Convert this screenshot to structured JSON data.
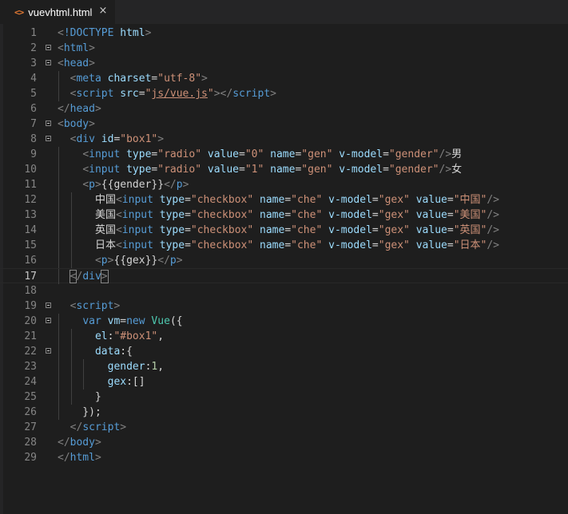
{
  "tab": {
    "icon": "html-file-icon",
    "title": "vuevhtml.html",
    "close": "×"
  },
  "colors": {
    "tag": "#569cd6",
    "bracket": "#808080",
    "attribute": "#9cdcfe",
    "string": "#ce9178",
    "text": "#d4d4d4",
    "keyword": "#569cd6",
    "class": "#4ec9b0",
    "number": "#b5cea8",
    "line_number": "#858585"
  },
  "lines": [
    {
      "n": "1",
      "tokens": [
        [
          "brk",
          "<"
        ],
        [
          "tag",
          "!DOCTYPE"
        ],
        [
          "txt",
          " "
        ],
        [
          "attr",
          "html"
        ],
        [
          "brk",
          ">"
        ]
      ]
    },
    {
      "n": "2",
      "tokens": [
        [
          "brk",
          "<"
        ],
        [
          "tag",
          "html"
        ],
        [
          "brk",
          ">"
        ]
      ]
    },
    {
      "n": "3",
      "tokens": [
        [
          "brk",
          "<"
        ],
        [
          "tag",
          "head"
        ],
        [
          "brk",
          ">"
        ]
      ]
    },
    {
      "n": "4",
      "tokens": [
        [
          "txt",
          "  "
        ],
        [
          "brk",
          "<"
        ],
        [
          "tag",
          "meta"
        ],
        [
          "txt",
          " "
        ],
        [
          "attr",
          "charset"
        ],
        [
          "txt",
          "="
        ],
        [
          "str",
          "\"utf-8\""
        ],
        [
          "brk",
          ">"
        ]
      ]
    },
    {
      "n": "5",
      "tokens": [
        [
          "txt",
          "  "
        ],
        [
          "brk",
          "<"
        ],
        [
          "tag",
          "script"
        ],
        [
          "txt",
          " "
        ],
        [
          "attr",
          "src"
        ],
        [
          "txt",
          "="
        ],
        [
          "str",
          "\""
        ],
        [
          "strlink",
          "js/vue.js"
        ],
        [
          "str",
          "\""
        ],
        [
          "brk",
          "></"
        ],
        [
          "tag",
          "script"
        ],
        [
          "brk",
          ">"
        ]
      ]
    },
    {
      "n": "6",
      "tokens": [
        [
          "brk",
          "</"
        ],
        [
          "tag",
          "head"
        ],
        [
          "brk",
          ">"
        ]
      ]
    },
    {
      "n": "7",
      "tokens": [
        [
          "brk",
          "<"
        ],
        [
          "tag",
          "body"
        ],
        [
          "brk",
          ">"
        ]
      ]
    },
    {
      "n": "8",
      "tokens": [
        [
          "txt",
          "  "
        ],
        [
          "brk",
          "<"
        ],
        [
          "tag",
          "div"
        ],
        [
          "txt",
          " "
        ],
        [
          "attr",
          "id"
        ],
        [
          "txt",
          "="
        ],
        [
          "str",
          "\"box1\""
        ],
        [
          "brk",
          ">"
        ]
      ]
    },
    {
      "n": "9",
      "tokens": [
        [
          "txt",
          "    "
        ],
        [
          "brk",
          "<"
        ],
        [
          "tag",
          "input"
        ],
        [
          "txt",
          " "
        ],
        [
          "attr",
          "type"
        ],
        [
          "txt",
          "="
        ],
        [
          "str",
          "\"radio\""
        ],
        [
          "txt",
          " "
        ],
        [
          "attr",
          "value"
        ],
        [
          "txt",
          "="
        ],
        [
          "str",
          "\"0\""
        ],
        [
          "txt",
          " "
        ],
        [
          "attr",
          "name"
        ],
        [
          "txt",
          "="
        ],
        [
          "str",
          "\"gen\""
        ],
        [
          "txt",
          " "
        ],
        [
          "attr",
          "v-model"
        ],
        [
          "txt",
          "="
        ],
        [
          "str",
          "\"gender\""
        ],
        [
          "brk",
          "/>"
        ],
        [
          "txt",
          "男"
        ]
      ]
    },
    {
      "n": "10",
      "tokens": [
        [
          "txt",
          "    "
        ],
        [
          "brk",
          "<"
        ],
        [
          "tag",
          "input"
        ],
        [
          "txt",
          " "
        ],
        [
          "attr",
          "type"
        ],
        [
          "txt",
          "="
        ],
        [
          "str",
          "\"radio\""
        ],
        [
          "txt",
          " "
        ],
        [
          "attr",
          "value"
        ],
        [
          "txt",
          "="
        ],
        [
          "str",
          "\"1\""
        ],
        [
          "txt",
          " "
        ],
        [
          "attr",
          "name"
        ],
        [
          "txt",
          "="
        ],
        [
          "str",
          "\"gen\""
        ],
        [
          "txt",
          " "
        ],
        [
          "attr",
          "v-model"
        ],
        [
          "txt",
          "="
        ],
        [
          "str",
          "\"gender\""
        ],
        [
          "brk",
          "/>"
        ],
        [
          "txt",
          "女"
        ]
      ]
    },
    {
      "n": "11",
      "tokens": [
        [
          "txt",
          "    "
        ],
        [
          "brk",
          "<"
        ],
        [
          "tag",
          "p"
        ],
        [
          "brk",
          ">"
        ],
        [
          "txt",
          "{{gender}}"
        ],
        [
          "brk",
          "</"
        ],
        [
          "tag",
          "p"
        ],
        [
          "brk",
          ">"
        ]
      ]
    },
    {
      "n": "12",
      "tokens": [
        [
          "txt",
          "      中国"
        ],
        [
          "brk",
          "<"
        ],
        [
          "tag",
          "input"
        ],
        [
          "txt",
          " "
        ],
        [
          "attr",
          "type"
        ],
        [
          "txt",
          "="
        ],
        [
          "str",
          "\"checkbox\""
        ],
        [
          "txt",
          " "
        ],
        [
          "attr",
          "name"
        ],
        [
          "txt",
          "="
        ],
        [
          "str",
          "\"che\""
        ],
        [
          "txt",
          " "
        ],
        [
          "attr",
          "v-model"
        ],
        [
          "txt",
          "="
        ],
        [
          "str",
          "\"gex\""
        ],
        [
          "txt",
          " "
        ],
        [
          "attr",
          "value"
        ],
        [
          "txt",
          "="
        ],
        [
          "str",
          "\"中国\""
        ],
        [
          "brk",
          "/>"
        ]
      ]
    },
    {
      "n": "13",
      "tokens": [
        [
          "txt",
          "      美国"
        ],
        [
          "brk",
          "<"
        ],
        [
          "tag",
          "input"
        ],
        [
          "txt",
          " "
        ],
        [
          "attr",
          "type"
        ],
        [
          "txt",
          "="
        ],
        [
          "str",
          "\"checkbox\""
        ],
        [
          "txt",
          " "
        ],
        [
          "attr",
          "name"
        ],
        [
          "txt",
          "="
        ],
        [
          "str",
          "\"che\""
        ],
        [
          "txt",
          " "
        ],
        [
          "attr",
          "v-model"
        ],
        [
          "txt",
          "="
        ],
        [
          "str",
          "\"gex\""
        ],
        [
          "txt",
          " "
        ],
        [
          "attr",
          "value"
        ],
        [
          "txt",
          "="
        ],
        [
          "str",
          "\"美国\""
        ],
        [
          "brk",
          "/>"
        ]
      ]
    },
    {
      "n": "14",
      "tokens": [
        [
          "txt",
          "      英国"
        ],
        [
          "brk",
          "<"
        ],
        [
          "tag",
          "input"
        ],
        [
          "txt",
          " "
        ],
        [
          "attr",
          "type"
        ],
        [
          "txt",
          "="
        ],
        [
          "str",
          "\"checkbox\""
        ],
        [
          "txt",
          " "
        ],
        [
          "attr",
          "name"
        ],
        [
          "txt",
          "="
        ],
        [
          "str",
          "\"che\""
        ],
        [
          "txt",
          " "
        ],
        [
          "attr",
          "v-model"
        ],
        [
          "txt",
          "="
        ],
        [
          "str",
          "\"gex\""
        ],
        [
          "txt",
          " "
        ],
        [
          "attr",
          "value"
        ],
        [
          "txt",
          "="
        ],
        [
          "str",
          "\"英国\""
        ],
        [
          "brk",
          "/>"
        ]
      ]
    },
    {
      "n": "15",
      "tokens": [
        [
          "txt",
          "      日本"
        ],
        [
          "brk",
          "<"
        ],
        [
          "tag",
          "input"
        ],
        [
          "txt",
          " "
        ],
        [
          "attr",
          "type"
        ],
        [
          "txt",
          "="
        ],
        [
          "str",
          "\"checkbox\""
        ],
        [
          "txt",
          " "
        ],
        [
          "attr",
          "name"
        ],
        [
          "txt",
          "="
        ],
        [
          "str",
          "\"che\""
        ],
        [
          "txt",
          " "
        ],
        [
          "attr",
          "v-model"
        ],
        [
          "txt",
          "="
        ],
        [
          "str",
          "\"gex\""
        ],
        [
          "txt",
          " "
        ],
        [
          "attr",
          "value"
        ],
        [
          "txt",
          "="
        ],
        [
          "str",
          "\"日本\""
        ],
        [
          "brk",
          "/>"
        ]
      ]
    },
    {
      "n": "16",
      "tokens": [
        [
          "txt",
          "      "
        ],
        [
          "brk",
          "<"
        ],
        [
          "tag",
          "p"
        ],
        [
          "brk",
          ">"
        ],
        [
          "txt",
          "{{gex}}"
        ],
        [
          "brk",
          "</"
        ],
        [
          "tag",
          "p"
        ],
        [
          "brk",
          ">"
        ]
      ]
    },
    {
      "n": "17",
      "tokens": [
        [
          "txt",
          "  "
        ],
        [
          "brkm",
          "<"
        ],
        [
          "brk",
          "/"
        ],
        [
          "tag",
          "div"
        ],
        [
          "brkm",
          ">"
        ]
      ]
    },
    {
      "n": "18",
      "tokens": []
    },
    {
      "n": "19",
      "tokens": [
        [
          "txt",
          "  "
        ],
        [
          "brk",
          "<"
        ],
        [
          "tag",
          "script"
        ],
        [
          "brk",
          ">"
        ]
      ]
    },
    {
      "n": "20",
      "tokens": [
        [
          "txt",
          "    "
        ],
        [
          "kw",
          "var"
        ],
        [
          "txt",
          " "
        ],
        [
          "attr",
          "vm"
        ],
        [
          "txt",
          "="
        ],
        [
          "kw",
          "new"
        ],
        [
          "txt",
          " "
        ],
        [
          "cls",
          "Vue"
        ],
        [
          "txt",
          "({"
        ]
      ]
    },
    {
      "n": "21",
      "tokens": [
        [
          "txt",
          "      "
        ],
        [
          "attr",
          "el"
        ],
        [
          "txt",
          ":"
        ],
        [
          "str",
          "\"#box1\""
        ],
        [
          "txt",
          ","
        ]
      ]
    },
    {
      "n": "22",
      "tokens": [
        [
          "txt",
          "      "
        ],
        [
          "attr",
          "data"
        ],
        [
          "txt",
          ":{"
        ]
      ]
    },
    {
      "n": "23",
      "tokens": [
        [
          "txt",
          "        "
        ],
        [
          "attr",
          "gender"
        ],
        [
          "txt",
          ":"
        ],
        [
          "num",
          "1"
        ],
        [
          "txt",
          ","
        ]
      ]
    },
    {
      "n": "24",
      "tokens": [
        [
          "txt",
          "        "
        ],
        [
          "attr",
          "gex"
        ],
        [
          "txt",
          ":[]"
        ]
      ]
    },
    {
      "n": "25",
      "tokens": [
        [
          "txt",
          "      }"
        ]
      ]
    },
    {
      "n": "26",
      "tokens": [
        [
          "txt",
          "    });"
        ]
      ]
    },
    {
      "n": "27",
      "tokens": [
        [
          "txt",
          "  "
        ],
        [
          "brk",
          "</"
        ],
        [
          "tag",
          "script"
        ],
        [
          "brk",
          ">"
        ]
      ]
    },
    {
      "n": "28",
      "tokens": [
        [
          "brk",
          "</"
        ],
        [
          "tag",
          "body"
        ],
        [
          "brk",
          ">"
        ]
      ]
    },
    {
      "n": "29",
      "tokens": [
        [
          "brk",
          "</"
        ],
        [
          "tag",
          "html"
        ],
        [
          "brk",
          ">"
        ]
      ]
    }
  ]
}
